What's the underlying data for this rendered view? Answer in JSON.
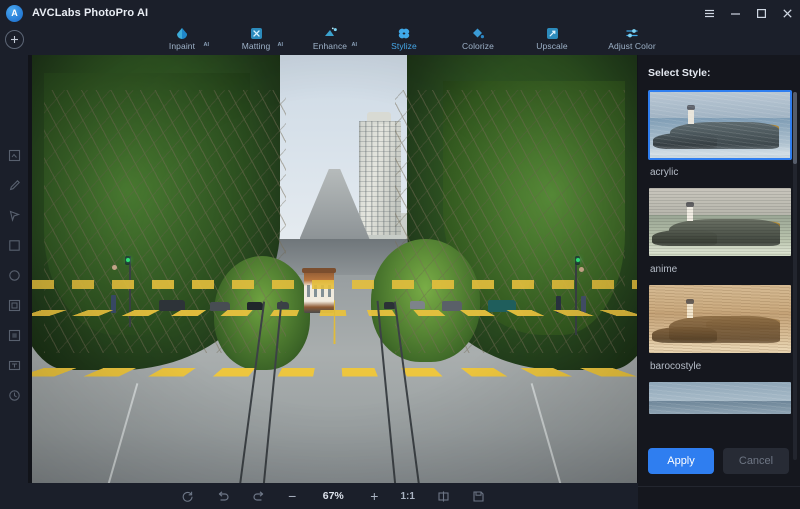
{
  "window": {
    "app_title": "AVCLabs PhotoPro AI",
    "logo_icon": "avclabs-logo-icon",
    "controls": [
      {
        "name": "menu-button",
        "icon": "hamburger-icon"
      },
      {
        "name": "minimize-button",
        "icon": "minimize-icon"
      },
      {
        "name": "maximize-button",
        "icon": "maximize-icon"
      },
      {
        "name": "close-button",
        "icon": "close-icon"
      }
    ]
  },
  "toolbar": {
    "add_button": {
      "name": "add-image-button",
      "icon": "plus-circle-icon"
    },
    "tools": [
      {
        "label": "Inpaint",
        "icon": "inpaint-icon",
        "badge": "AI",
        "active": false
      },
      {
        "label": "Matting",
        "icon": "matting-icon",
        "badge": "AI",
        "active": false
      },
      {
        "label": "Enhance",
        "icon": "enhance-icon",
        "badge": "AI",
        "active": false
      },
      {
        "label": "Stylize",
        "icon": "stylize-icon",
        "badge": "",
        "active": true
      },
      {
        "label": "Colorize",
        "icon": "colorize-icon",
        "badge": "",
        "active": false
      },
      {
        "label": "Upscale",
        "icon": "upscale-icon",
        "badge": "",
        "active": false
      },
      {
        "label": "Adjust Color",
        "icon": "adjust-color-icon",
        "badge": "",
        "active": false
      }
    ]
  },
  "left_rail": {
    "items": [
      {
        "name": "sidebar-tool-crop",
        "icon": "crop-frame-icon"
      },
      {
        "name": "sidebar-tool-brush",
        "icon": "brush-icon"
      },
      {
        "name": "sidebar-tool-lasso",
        "icon": "lasso-icon"
      },
      {
        "name": "sidebar-tool-rectangle",
        "icon": "rectangle-icon"
      },
      {
        "name": "sidebar-tool-ellipse",
        "icon": "ellipse-icon"
      },
      {
        "name": "sidebar-tool-layers",
        "icon": "layers-icon"
      },
      {
        "name": "sidebar-tool-frame",
        "icon": "frame-icon"
      },
      {
        "name": "sidebar-tool-text",
        "icon": "text-box-icon"
      },
      {
        "name": "sidebar-tool-history",
        "icon": "history-clock-icon"
      }
    ]
  },
  "canvas": {
    "image_alt": "San Francisco hill street with cable car and tree-lined sidewalks"
  },
  "bottom_bar": {
    "items": [
      {
        "name": "rotate-button",
        "icon": "rotate-icon",
        "label": ""
      },
      {
        "name": "undo-button",
        "icon": "undo-arrow-icon",
        "label": ""
      },
      {
        "name": "redo-button",
        "icon": "redo-arrow-icon",
        "label": ""
      },
      {
        "name": "zoom-out-button",
        "icon": "minus-icon",
        "label": "−"
      },
      {
        "name": "zoom-level",
        "icon": "",
        "label": "67%"
      },
      {
        "name": "zoom-in-button",
        "icon": "plus-icon",
        "label": "+"
      },
      {
        "name": "actual-size-button",
        "icon": "",
        "label": "1:1"
      },
      {
        "name": "compare-button",
        "icon": "split-compare-icon",
        "label": ""
      },
      {
        "name": "save-button",
        "icon": "save-disk-icon",
        "label": ""
      }
    ]
  },
  "right_panel": {
    "title": "Select Style:",
    "styles": [
      {
        "label": "acrylic",
        "selected": true
      },
      {
        "label": "anime",
        "selected": false
      },
      {
        "label": "barocostyle",
        "selected": false
      },
      {
        "label": "",
        "selected": false
      }
    ],
    "apply_label": "Apply",
    "cancel_label": "Cancel"
  },
  "colors": {
    "accent": "#2f7ef0",
    "active_tab": "#46a8e8",
    "chrome": "#1b1f2a",
    "panel": "#15171e"
  }
}
